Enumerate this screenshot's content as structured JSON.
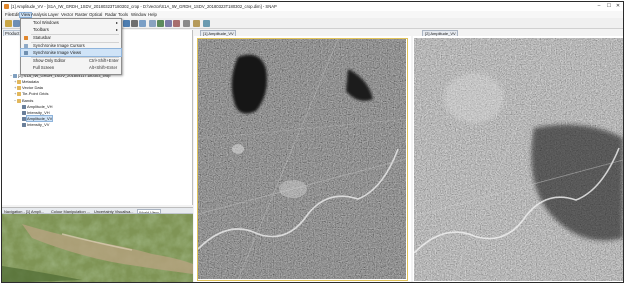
{
  "titlebar": {
    "title": "[1] Amplitude_VV - [S1A_IW_GRDH_1SDV_20180323T180302_crop - D:\\Vector\\S1A_IW_GRDH_1SDV_20180323T180302_crop.dim] - SNAP",
    "minimize": "–",
    "maximize": "☐",
    "close": "✕"
  },
  "menubar": {
    "items": [
      "File",
      "Edit",
      "View",
      "Analysis",
      "Layer",
      "Vector",
      "Raster",
      "Optical",
      "Radar",
      "Tools",
      "Window",
      "Help"
    ]
  },
  "view_menu": {
    "items": [
      {
        "label": "Tool Windows",
        "shortcut": "",
        "submenu": true
      },
      {
        "label": "Toolbars",
        "shortcut": "",
        "submenu": true
      },
      {
        "label": "Statusbar",
        "shortcut": ""
      },
      {
        "label": "Synchronise Image Cursors",
        "shortcut": ""
      },
      {
        "label": "Synchronise Image Views",
        "shortcut": ""
      },
      {
        "label": "Show Only Editor",
        "shortcut": "Ctrl+Shift+Enter"
      },
      {
        "label": "Full Screen",
        "shortcut": "Alt+Shift+Enter"
      }
    ]
  },
  "product_explorer": {
    "tab_label": "Product Explorer",
    "rows": [
      {
        "label": "Amplitude_VV",
        "indent": 3,
        "kind": "band"
      },
      {
        "label": "Intensity_VH",
        "indent": 3,
        "kind": "band"
      },
      {
        "label": "Amplitude_VH",
        "indent": 3,
        "kind": "band"
      },
      {
        "label": "Intensity_VV",
        "indent": 3,
        "kind": "band"
      },
      {
        "label": "[2] S1A_IW_GRDH_1SDV_20180411T180303_crop",
        "indent": 0,
        "kind": "prod",
        "toggle": "−"
      },
      {
        "label": "Metadata",
        "indent": 1,
        "kind": "folder",
        "toggle": "+"
      },
      {
        "label": "Vector Data",
        "indent": 1,
        "kind": "folder",
        "toggle": "+"
      },
      {
        "label": "Tie-Point Grids",
        "indent": 1,
        "kind": "folder",
        "toggle": "+"
      },
      {
        "label": "Bands",
        "indent": 1,
        "kind": "folder",
        "toggle": "−"
      },
      {
        "label": "Amplitude_VH",
        "indent": 3,
        "kind": "band"
      },
      {
        "label": "Intensity_VH",
        "indent": 3,
        "kind": "band"
      },
      {
        "label": "Amplitude_VV",
        "indent": 3,
        "kind": "band",
        "selected": true
      },
      {
        "label": "Intensity_VV",
        "indent": 3,
        "kind": "band"
      }
    ]
  },
  "bottom_tabs": [
    "Navigation - [1] Ampli...",
    "Colour Manipulation ...",
    "Uncertainty Visualisa...",
    "World View"
  ],
  "views": {
    "view1_tab": "[1] Amplitude_VV",
    "view2_tab": "[2] Amplitude_VV"
  },
  "colors": {
    "accent_highlight": "#cfe3f7",
    "active_view_border": "#e0c35a",
    "app_icon": "#e0862b"
  }
}
